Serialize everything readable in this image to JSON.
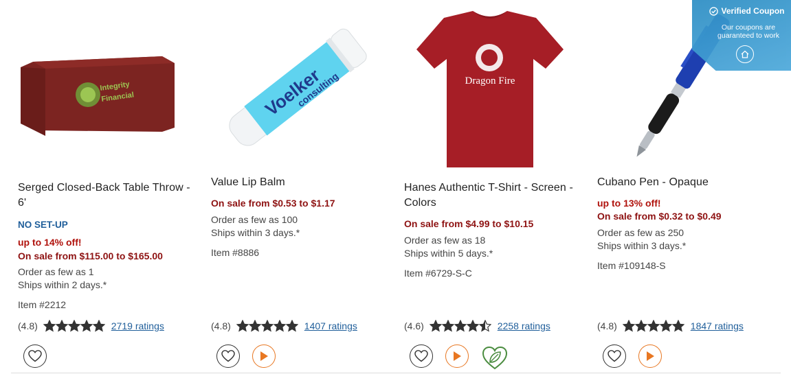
{
  "products": [
    {
      "name": "Serged Closed-Back Table Throw - 6'",
      "badge": "NO SET-UP",
      "discount": "up to 14% off!",
      "sale": "On sale from $115.00 to $165.00",
      "order_min": "Order as few as 1",
      "ships": "Ships within 2 days.*",
      "item": "Item #2212",
      "rating": "(4.8)",
      "rating_value": 4.8,
      "ratings_count": "2719 ratings",
      "image_icon": "table-throw-image",
      "image_text": [
        "Integrity",
        "Financial"
      ]
    },
    {
      "name": "Value Lip Balm",
      "sale": "On sale from $0.53 to $1.17",
      "order_min": "Order as few as 100",
      "ships": "Ships within 3 days.*",
      "item": "Item #8886",
      "rating": "(4.8)",
      "rating_value": 4.8,
      "ratings_count": "1407 ratings",
      "image_icon": "lip-balm-image",
      "image_text": [
        "Voelker",
        "consulting"
      ]
    },
    {
      "name": "Hanes Authentic T-Shirt - Screen - Colors",
      "sale": "On sale from $4.99 to $10.15",
      "order_min": "Order as few as 18",
      "ships": "Ships within 5 days.*",
      "item": "Item #6729-S-C",
      "rating": "(4.6)",
      "rating_value": 4.6,
      "ratings_count": "2258 ratings",
      "image_icon": "t-shirt-image",
      "image_text": [
        "Dragon Fire"
      ]
    },
    {
      "name": "Cubano Pen - Opaque",
      "discount": "up to 13% off!",
      "sale": "On sale from $0.32 to $0.49",
      "order_min": "Order as few as 250",
      "ships": "Ships within 3 days.*",
      "item": "Item #109148-S",
      "rating": "(4.8)",
      "rating_value": 4.8,
      "ratings_count": "1847 ratings",
      "image_icon": "pen-image"
    }
  ],
  "coupon": {
    "title": "Verified Coupon",
    "subtitle": "Our coupons are guaranteed to work",
    "icon": "home-icon"
  },
  "colors": {
    "sale_red": "#8e1212",
    "discount_red": "#b0120c",
    "link_blue": "#1f5e9a",
    "play_orange": "#e87722",
    "eco_green": "#4a8c3f",
    "coupon_blue": "#3a9bd0"
  }
}
